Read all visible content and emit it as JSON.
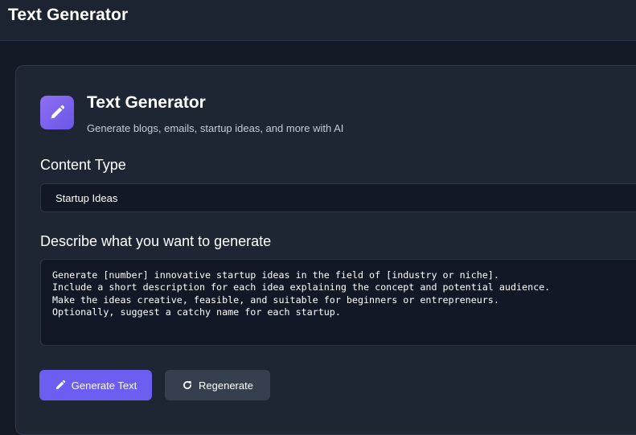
{
  "header": {
    "title": "Text Generator"
  },
  "card": {
    "icon": "pencil-icon",
    "title": "Text Generator",
    "subtitle": "Generate blogs, emails, startup ideas, and more with AI"
  },
  "content_type": {
    "label": "Content Type",
    "selected": "Startup Ideas"
  },
  "prompt": {
    "label": "Describe what you want to generate",
    "value": "Generate [number] innovative startup ideas in the field of [industry or niche].\nInclude a short description for each idea explaining the concept and potential audience.\nMake the ideas creative, feasible, and suitable for beginners or entrepreneurs.\nOptionally, suggest a catchy name for each startup."
  },
  "actions": {
    "generate_label": "Generate Text",
    "generate_icon": "pencil-icon",
    "regenerate_label": "Regenerate",
    "regenerate_icon": "refresh-icon"
  },
  "colors": {
    "accent": "#6b5ef0",
    "background": "#131a26",
    "card": "#1e2533"
  }
}
